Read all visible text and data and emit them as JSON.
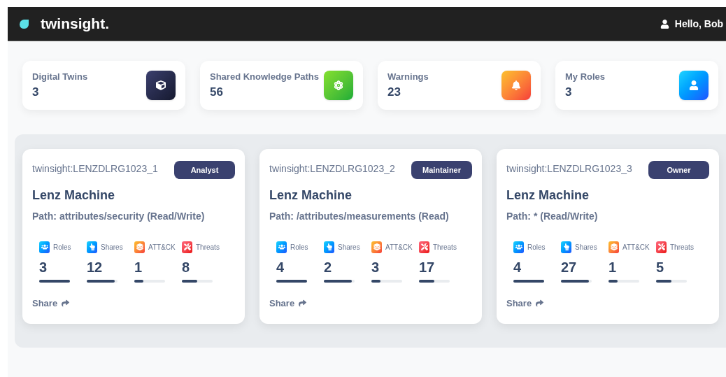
{
  "navbar": {
    "brand": "twinsight.",
    "greeting": "Hello, Bob"
  },
  "stats": [
    {
      "label": "Digital Twins",
      "value": "3",
      "kind": "twins"
    },
    {
      "label": "Shared Knowledge Paths",
      "value": "56",
      "kind": "paths"
    },
    {
      "label": "Warnings",
      "value": "23",
      "kind": "warnings"
    },
    {
      "label": "My Roles",
      "value": "3",
      "kind": "roles"
    }
  ],
  "twins": [
    {
      "id": "twinsight:LENZDLRG1023_1",
      "role": "Analyst",
      "name": "Lenz Machine",
      "path": "Path: attributes/security (Read/Write)",
      "share": "Share",
      "metrics": [
        {
          "kind": "roles",
          "label": "Roles",
          "value": "3",
          "level": 1
        },
        {
          "kind": "shares",
          "label": "Shares",
          "value": "12",
          "level": 0.9
        },
        {
          "kind": "attck",
          "label": "ATT&CK",
          "value": "1",
          "level": 0.3
        },
        {
          "kind": "threats",
          "label": "Threats",
          "value": "8",
          "level": 0.5
        }
      ]
    },
    {
      "id": "twinsight:LENZDLRG1023_2",
      "role": "Maintainer",
      "name": "Lenz Machine",
      "path": "Path: /attributes/measurements (Read)",
      "share": "Share",
      "metrics": [
        {
          "kind": "roles",
          "label": "Roles",
          "value": "4",
          "level": 1
        },
        {
          "kind": "shares",
          "label": "Shares",
          "value": "2",
          "level": 0.9
        },
        {
          "kind": "attck",
          "label": "ATT&CK",
          "value": "3",
          "level": 0.3
        },
        {
          "kind": "threats",
          "label": "Threats",
          "value": "17",
          "level": 0.5
        }
      ]
    },
    {
      "id": "twinsight:LENZDLRG1023_3",
      "role": "Owner",
      "name": "Lenz Machine",
      "path": "Path: * (Read/Write)",
      "share": "Share",
      "metrics": [
        {
          "kind": "roles",
          "label": "Roles",
          "value": "4",
          "level": 1
        },
        {
          "kind": "shares",
          "label": "Shares",
          "value": "27",
          "level": 0.9
        },
        {
          "kind": "attck",
          "label": "ATT&CK",
          "value": "1",
          "level": 0.3
        },
        {
          "kind": "threats",
          "label": "Threats",
          "value": "5",
          "level": 0.5
        }
      ]
    }
  ]
}
